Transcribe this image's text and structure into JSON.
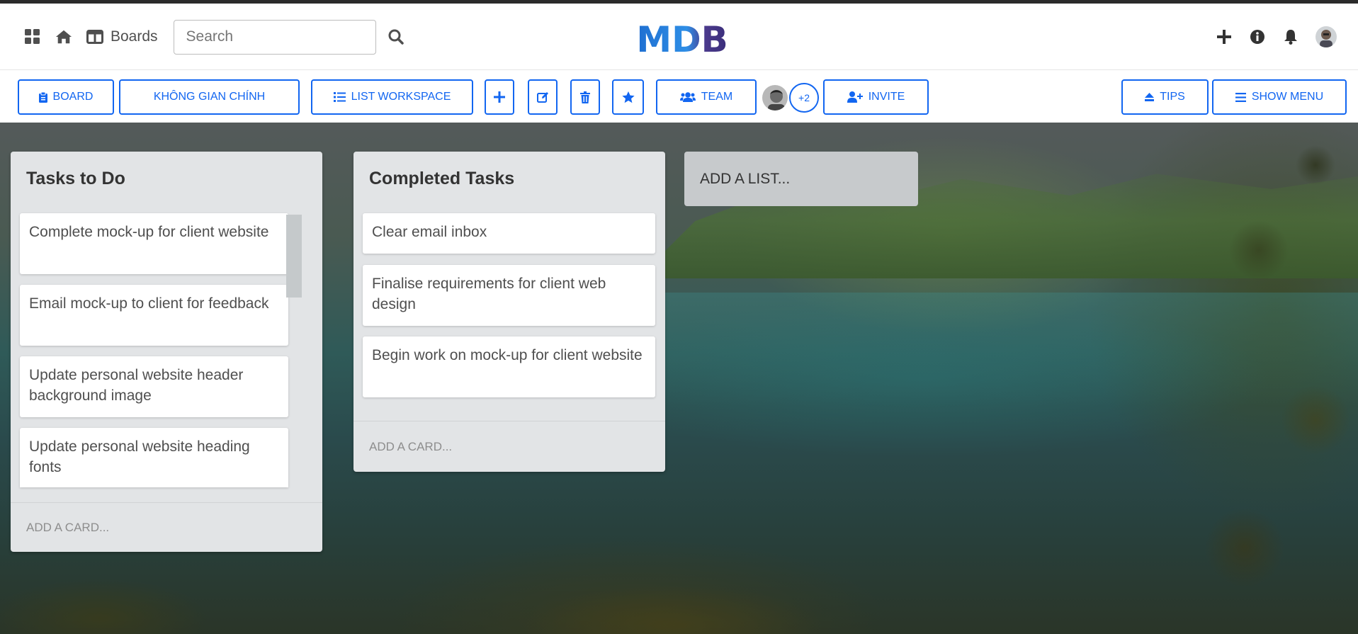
{
  "navbar": {
    "boards_label": "Boards",
    "search_placeholder": "Search",
    "logo_text": "MDB"
  },
  "toolbar": {
    "board_label": "Board",
    "workspace_label": "KHÔNG GIAN CHÍNH",
    "list_workspace_label": "List Workspace",
    "team_label": "Team",
    "team_extra_count": "+2",
    "invite_label": "Invite",
    "tips_label": "Tips",
    "show_menu_label": "Show Menu"
  },
  "lists": [
    {
      "title": "Tasks to Do",
      "cards": [
        "Complete mock-up for client website",
        "Email mock-up to client for feedback",
        "Update personal website header background image",
        "Update personal website heading fonts"
      ],
      "add_card_label": "Add a card..."
    },
    {
      "title": "Completed Tasks",
      "cards": [
        "Clear email inbox",
        "Finalise requirements for client web design",
        "Begin work on mock-up for client website"
      ],
      "add_card_label": "Add a card..."
    }
  ],
  "add_list_label": "Add a list...",
  "colors": {
    "accent": "#1266f1",
    "list_bg": "#e2e4e6",
    "logo_blue": "#1f6fd1",
    "logo_purple": "#4b3a8c"
  },
  "icons": [
    "apps-icon",
    "home-icon",
    "boards-icon",
    "search-icon",
    "plus-icon",
    "info-icon",
    "bell-icon",
    "clipboard-icon",
    "list-icon",
    "edit-icon",
    "trash-icon",
    "star-icon",
    "users-icon",
    "user-plus-icon",
    "eject-icon",
    "bars-icon"
  ]
}
